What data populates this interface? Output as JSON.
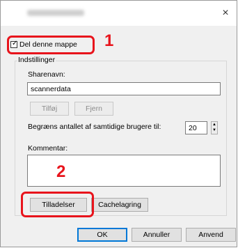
{
  "dialog": {
    "close_glyph": "×"
  },
  "share": {
    "checkbox_label": "Del denne mappe",
    "checked": true,
    "check_glyph": "✓"
  },
  "settings": {
    "group_label": "Indstillinger",
    "sharename_label": "Sharenavn:",
    "sharename_value": "scannerdata",
    "add_button": "Tilføj",
    "remove_button": "Fjern",
    "limit_label": "Begræns antallet af samtidige brugere til:",
    "limit_value": "20",
    "comment_label": "Kommentar:",
    "comment_value": "",
    "permissions_button": "Tilladelser",
    "caching_button": "Cachelagring"
  },
  "footer": {
    "ok": "OK",
    "cancel": "Annuller",
    "apply": "Anvend"
  },
  "callouts": {
    "one": "1",
    "two": "2",
    "color": "#e8141c"
  }
}
